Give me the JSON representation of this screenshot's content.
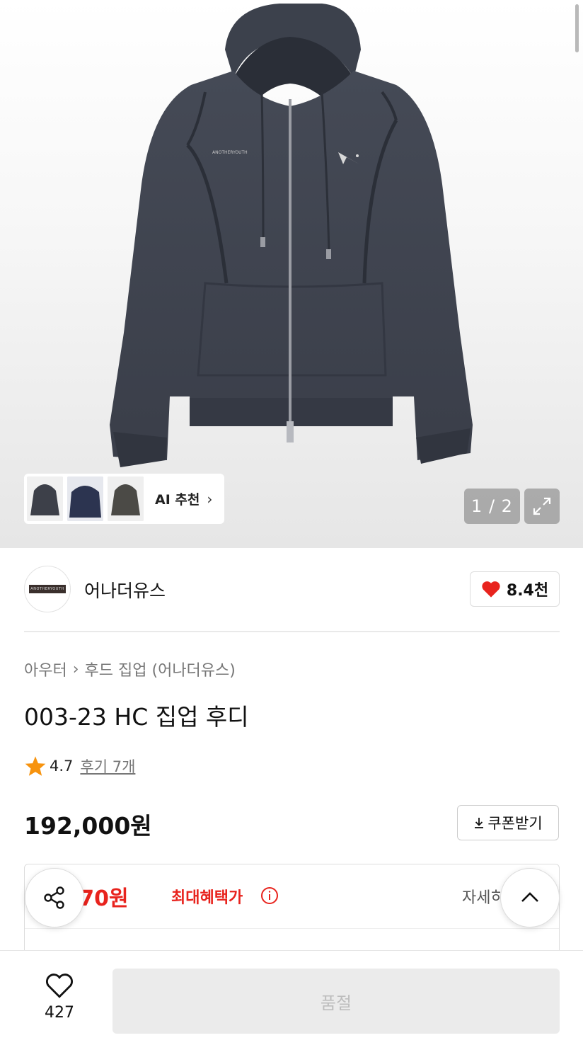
{
  "gallery": {
    "counter": "1 / 2",
    "ai_recommend_label": "AI 추천",
    "print_text": "ANOTHERYOUTH"
  },
  "brand": {
    "name": "어나더유스",
    "logo_text": "ANOTHERYOUTH",
    "likes": "8.4천"
  },
  "product": {
    "breadcrumb": [
      "아우터",
      "후드 집업 (어나더유스)"
    ],
    "title": "003-23 HC 집업 후디",
    "rating": "4.7",
    "reviews": "후기 7개",
    "price": "192,000원",
    "coupon_label": "쿠폰받기"
  },
  "benefit": {
    "price": ",870원",
    "label": "최대혜택가",
    "detail": "자세히"
  },
  "bottom": {
    "wish_count": "427",
    "buy_label": "품절"
  },
  "colors": {
    "accent_red": "#e8231d",
    "heart_red": "#e8231d",
    "star": "#f7930e",
    "garment": "#3e434f"
  }
}
